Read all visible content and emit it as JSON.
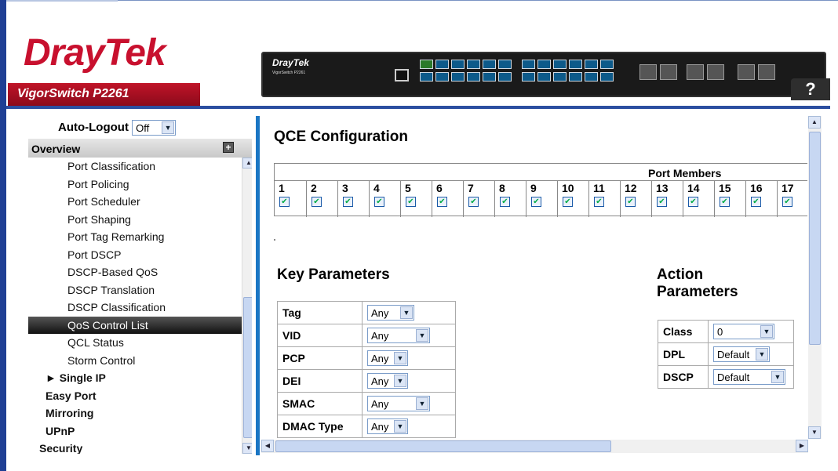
{
  "brand": {
    "logo_dray": "Dray",
    "logo_tek": "Tek",
    "model": "VigorSwitch P2261",
    "panel_brand": "DrayTek",
    "panel_sub": "VigorSwitch P2261"
  },
  "help": {
    "label": "?"
  },
  "sidebar": {
    "autologout_label": "Auto-Logout",
    "autologout_value": "Off",
    "overview_label": "Overview",
    "items": [
      {
        "label": "Port Classification"
      },
      {
        "label": "Port Policing"
      },
      {
        "label": "Port Scheduler"
      },
      {
        "label": "Port Shaping"
      },
      {
        "label": "Port Tag Remarking"
      },
      {
        "label": "Port DSCP"
      },
      {
        "label": "DSCP-Based QoS"
      },
      {
        "label": "DSCP Translation"
      },
      {
        "label": "DSCP Classification"
      },
      {
        "label": "QoS Control List"
      },
      {
        "label": "QCL Status"
      },
      {
        "label": "Storm Control"
      },
      {
        "label": "► Single IP"
      },
      {
        "label": "Easy Port"
      },
      {
        "label": "Mirroring"
      },
      {
        "label": "UPnP"
      },
      {
        "label": "Security"
      }
    ]
  },
  "main": {
    "title": "QCE Configuration",
    "port_members_label": "Port Members",
    "ports": [
      "1",
      "2",
      "3",
      "4",
      "5",
      "6",
      "7",
      "8",
      "9",
      "10",
      "11",
      "12",
      "13",
      "14",
      "15",
      "16",
      "17"
    ],
    "key_params_title": "Key Parameters",
    "key_params": [
      {
        "label": "Tag",
        "value": "Any"
      },
      {
        "label": "VID",
        "value": "Any"
      },
      {
        "label": "PCP",
        "value": "Any"
      },
      {
        "label": "DEI",
        "value": "Any"
      },
      {
        "label": "SMAC",
        "value": "Any"
      },
      {
        "label": "DMAC Type",
        "value": "Any"
      }
    ],
    "action_title_1": "Action",
    "action_title_2": "Parameters",
    "action_params": [
      {
        "label": "Class",
        "value": "0"
      },
      {
        "label": "DPL",
        "value": "Default"
      },
      {
        "label": "DSCP",
        "value": "Default"
      }
    ]
  }
}
